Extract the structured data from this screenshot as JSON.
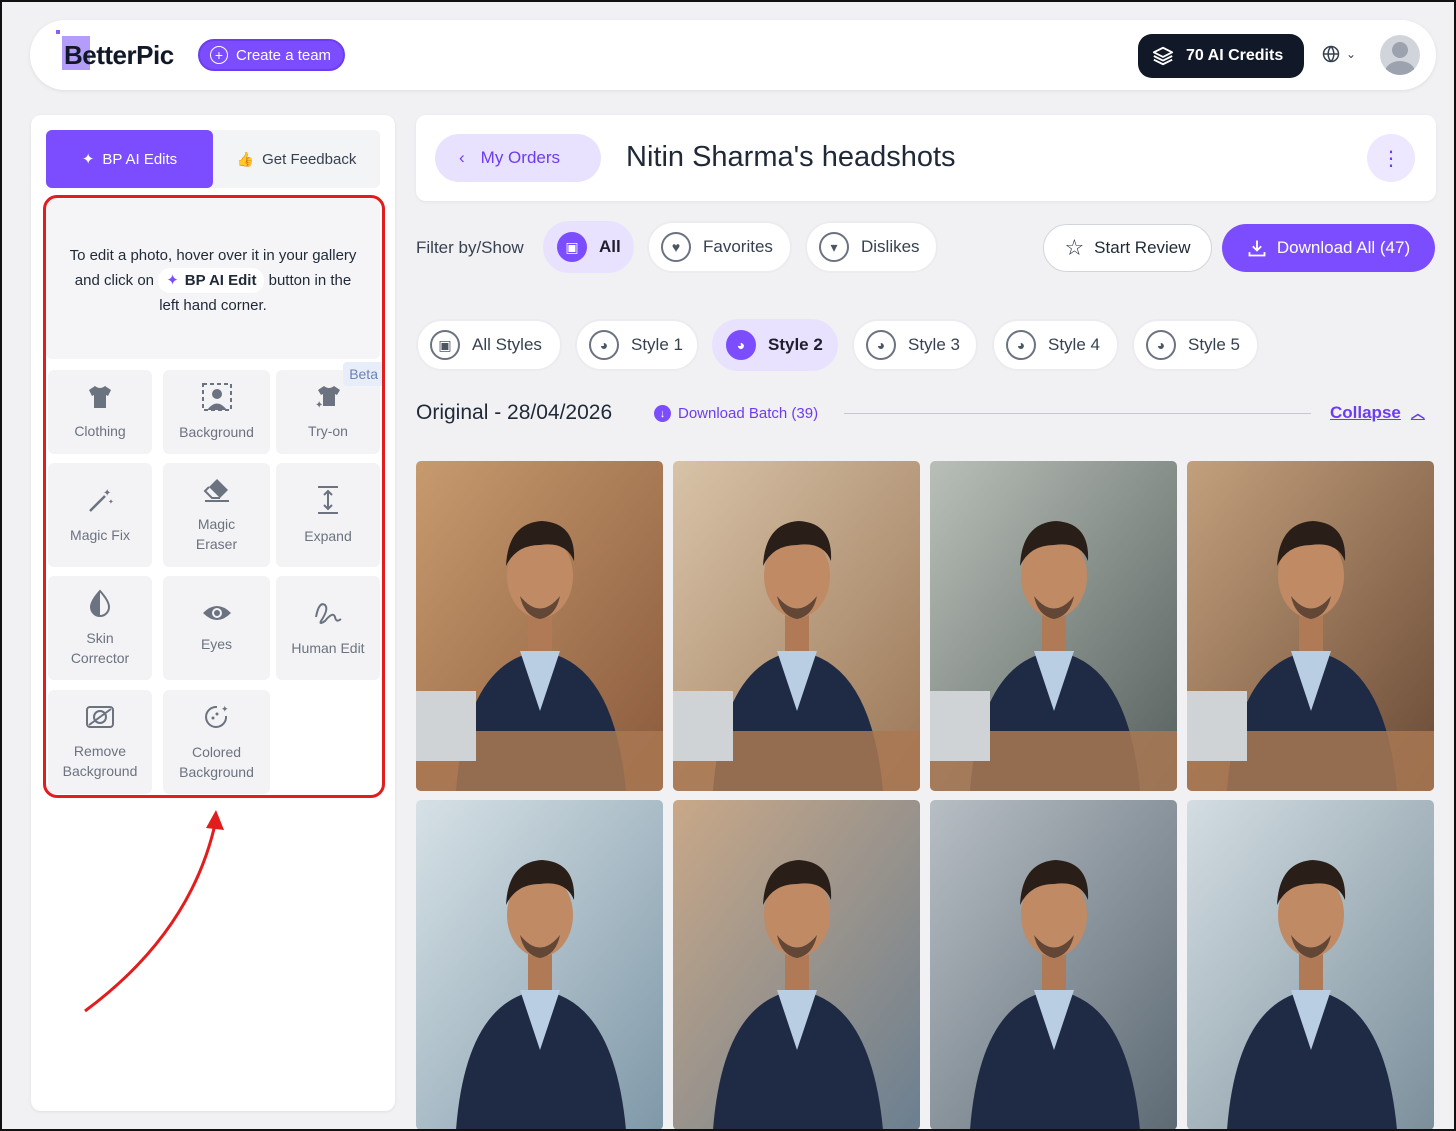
{
  "app": {
    "logo": "BetterPic",
    "create_team": "Create a team",
    "credits": "70 AI Credits"
  },
  "sidebar": {
    "tabs": [
      {
        "label": "BP AI Edits",
        "active": true
      },
      {
        "label": "Get Feedback",
        "active": false
      }
    ],
    "hint": {
      "line1": "To edit a photo, hover over it in your gallery",
      "and_click_on": "and click on",
      "chip": "BP AI Edit",
      "button_in_the": "button in the",
      "line3": "left hand corner."
    },
    "beta_label": "Beta",
    "tools": [
      {
        "label": "Clothing",
        "icon": "shirt-icon"
      },
      {
        "label": "Background",
        "icon": "background-person-icon"
      },
      {
        "label": "Try-on",
        "icon": "try-on-shirt-icon"
      },
      {
        "label": "Magic Fix",
        "icon": "magic-wand-icon"
      },
      {
        "label": "Magic Eraser",
        "icon": "eraser-icon"
      },
      {
        "label": "Expand",
        "icon": "expand-vertical-icon"
      },
      {
        "label": "Skin Corrector",
        "icon": "contrast-drop-icon"
      },
      {
        "label": "Eyes",
        "icon": "eye-icon"
      },
      {
        "label": "Human Edit",
        "icon": "squiggle-icon"
      },
      {
        "label": "Remove Background",
        "icon": "remove-bg-icon"
      },
      {
        "label": "Colored Background",
        "icon": "colored-bg-icon"
      }
    ]
  },
  "header": {
    "back_label": "My Orders",
    "title": "Nitin Sharma's headshots"
  },
  "filters": {
    "label": "Filter by/Show",
    "options": [
      {
        "label": "All",
        "active": true
      },
      {
        "label": "Favorites",
        "active": false
      },
      {
        "label": "Dislikes",
        "active": false
      }
    ],
    "start_review": "Start Review",
    "download_all": "Download All (47)"
  },
  "styles": [
    {
      "label": "All Styles",
      "active": false
    },
    {
      "label": "Style 1",
      "active": false
    },
    {
      "label": "Style 2",
      "active": true
    },
    {
      "label": "Style 3",
      "active": false
    },
    {
      "label": "Style 4",
      "active": false
    },
    {
      "label": "Style 5",
      "active": false
    }
  ],
  "batch": {
    "title": "Original - 28/04/2026",
    "download": "Download Batch (39)",
    "collapse": "Collapse"
  },
  "colors": {
    "accent": "#7c4dff",
    "accent_light": "#e9e2ff",
    "annotation_red": "#e11d1d"
  }
}
